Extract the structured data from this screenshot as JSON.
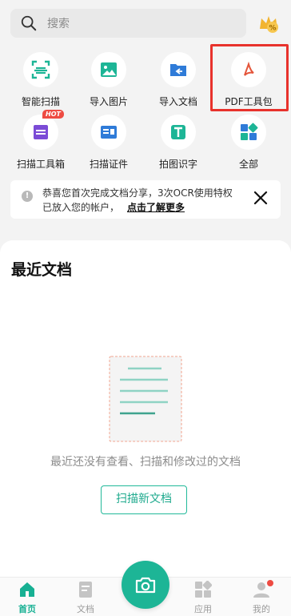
{
  "search": {
    "placeholder": "搜索"
  },
  "tools": [
    {
      "label": "智能扫描",
      "icon": "smart-scan-icon"
    },
    {
      "label": "导入图片",
      "icon": "import-image-icon"
    },
    {
      "label": "导入文档",
      "icon": "import-doc-icon"
    },
    {
      "label": "PDF工具包",
      "icon": "pdf-icon"
    },
    {
      "label": "扫描工具箱",
      "icon": "scan-toolbox-icon",
      "badge": "HOT"
    },
    {
      "label": "扫描证件",
      "icon": "id-card-icon"
    },
    {
      "label": "拍图识字",
      "icon": "ocr-text-icon"
    },
    {
      "label": "全部",
      "icon": "all-apps-icon"
    }
  ],
  "notice": {
    "line1": "恭喜您首次完成文档分享，3次OCR使用特权",
    "line2": "已放入您的帐户，",
    "link": "点击了解更多"
  },
  "recent": {
    "title": "最近文档",
    "empty_text": "最近还没有查看、扫描和修改过的文档",
    "scan_button": "扫描新文档"
  },
  "tabbar": {
    "home": "首页",
    "docs": "文档",
    "apps": "应用",
    "me": "我的"
  },
  "colors": {
    "accent": "#1db596",
    "highlight": "#e8322c",
    "hot_badge": "#ee4b42"
  }
}
